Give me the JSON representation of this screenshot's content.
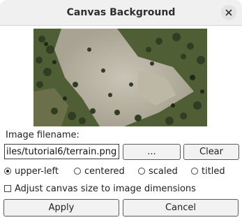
{
  "window": {
    "title": "Canvas Background"
  },
  "filename": {
    "label": "Image filename:",
    "value": "iles/tutorial6/terrain.png"
  },
  "buttons": {
    "browse": "...",
    "clear": "Clear",
    "apply": "Apply",
    "cancel": "Cancel"
  },
  "position_options": [
    {
      "label": "upper-left",
      "selected": true
    },
    {
      "label": "centered",
      "selected": false
    },
    {
      "label": "scaled",
      "selected": false
    },
    {
      "label": "titled",
      "selected": false
    }
  ],
  "adjust_size": {
    "label": "Adjust canvas size to image dimensions",
    "checked": false
  },
  "icons": {
    "close": "close-icon"
  }
}
